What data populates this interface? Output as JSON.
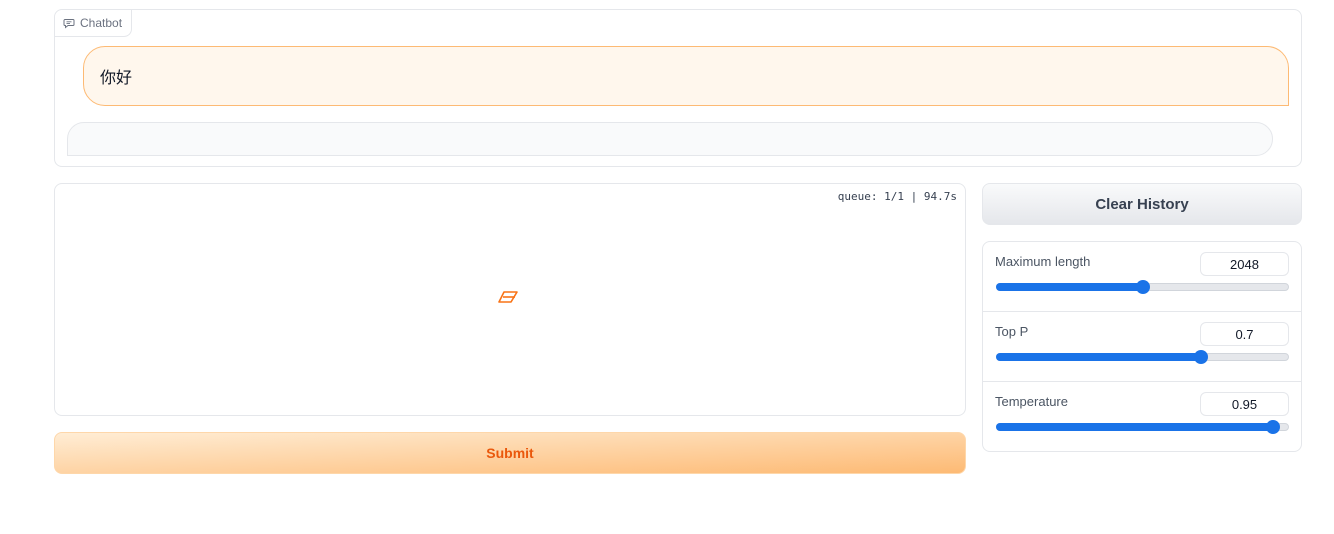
{
  "chatbot": {
    "label": "Chatbot",
    "messages": [
      {
        "role": "user",
        "text": "你好"
      },
      {
        "role": "bot",
        "text": ""
      }
    ]
  },
  "input_area": {
    "queue_status": "queue: 1/1 | 94.7s",
    "loader_icon": "loading-spinner-icon"
  },
  "buttons": {
    "submit_label": "Submit",
    "clear_label": "Clear History"
  },
  "settings": {
    "sliders": [
      {
        "label": "Maximum length",
        "value": "2048",
        "fraction": 0.5
      },
      {
        "label": "Top P",
        "value": "0.7",
        "fraction": 0.7
      },
      {
        "label": "Temperature",
        "value": "0.95",
        "fraction": 0.95
      }
    ]
  },
  "colors": {
    "accent_orange": "#ea580c",
    "slider_blue": "#1a73e8",
    "user_bubble_bg": "#fff7ed",
    "user_bubble_border": "#fdba74"
  }
}
